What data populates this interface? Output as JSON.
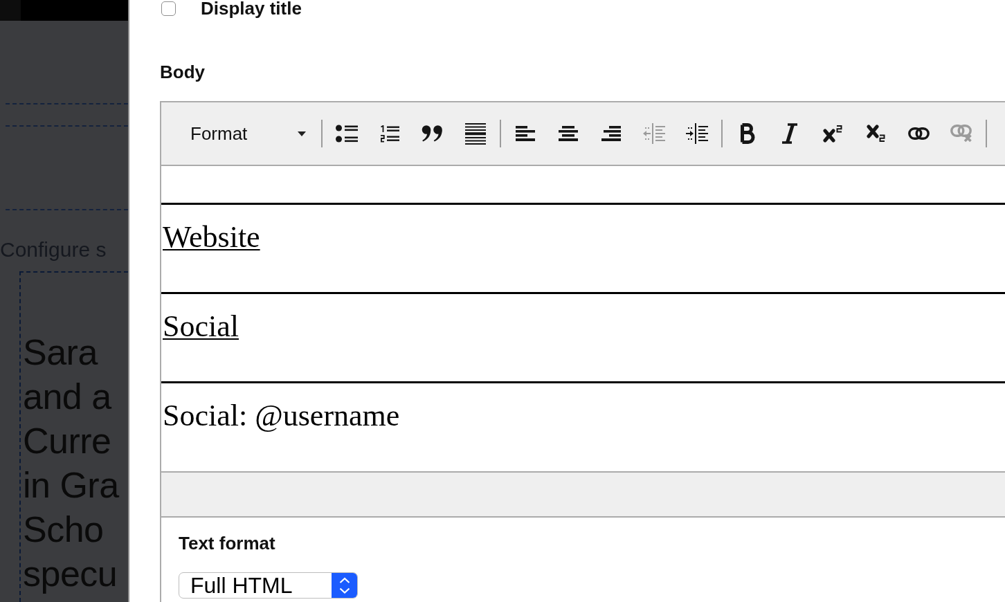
{
  "sidebar": {
    "section_label": "Configure s",
    "text_lines": [
      "Sara",
      "and a",
      "Curre",
      "in Gra",
      "Scho",
      "specu"
    ]
  },
  "display_title": {
    "label": "Display title",
    "checked": false
  },
  "body": {
    "label": "Body",
    "toolbar": {
      "format": {
        "label": "Format"
      },
      "groups": [
        {
          "buttons": [
            {
              "kind": "bulleted-list",
              "disabled": false
            },
            {
              "kind": "numbered-list",
              "disabled": false
            },
            {
              "kind": "blockquote",
              "disabled": false
            },
            {
              "kind": "horizontal-line",
              "disabled": false
            }
          ]
        },
        {
          "buttons": [
            {
              "kind": "align-left",
              "disabled": false
            },
            {
              "kind": "align-center",
              "disabled": false
            },
            {
              "kind": "align-right",
              "disabled": false
            },
            {
              "kind": "outdent",
              "disabled": true
            },
            {
              "kind": "indent",
              "disabled": false
            }
          ]
        },
        {
          "buttons": [
            {
              "kind": "bold",
              "disabled": false
            },
            {
              "kind": "italic",
              "disabled": false
            },
            {
              "kind": "superscript",
              "disabled": false
            },
            {
              "kind": "subscript",
              "disabled": false
            },
            {
              "kind": "link",
              "disabled": false
            },
            {
              "kind": "unlink",
              "disabled": true
            }
          ]
        }
      ]
    },
    "content": [
      {
        "kind": "link",
        "text": "Website"
      },
      {
        "kind": "link",
        "text": "Social"
      },
      {
        "kind": "text",
        "text": "Social: @username"
      }
    ]
  },
  "text_format": {
    "label": "Text format",
    "value": "Full HTML"
  }
}
